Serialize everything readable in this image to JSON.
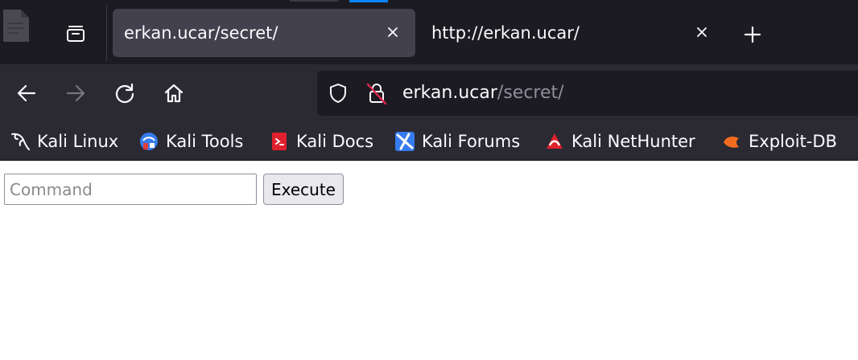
{
  "tabs": [
    {
      "title": "erkan.ucar/secret/",
      "active": true
    },
    {
      "title": "http://erkan.ucar/",
      "active": false
    }
  ],
  "nav": {
    "url_host": "erkan.ucar",
    "url_path": "/secret/"
  },
  "bookmarks": [
    {
      "label": "Kali Linux",
      "icon": "kali-dragon-icon"
    },
    {
      "label": "Kali Tools",
      "icon": "kali-tools-icon"
    },
    {
      "label": "Kali Docs",
      "icon": "kali-docs-icon"
    },
    {
      "label": "Kali Forums",
      "icon": "kali-forums-icon"
    },
    {
      "label": "Kali NetHunter",
      "icon": "kali-nethunter-icon"
    },
    {
      "label": "Exploit-DB",
      "icon": "exploit-db-icon"
    }
  ],
  "form": {
    "command_placeholder": "Command",
    "command_value": "",
    "execute_label": "Execute"
  },
  "colors": {
    "tabstrip_bg": "#1c1b22",
    "toolbar_bg": "#2b2a33",
    "active_tab_bg": "#42414d",
    "accent": "#0a84ff"
  }
}
